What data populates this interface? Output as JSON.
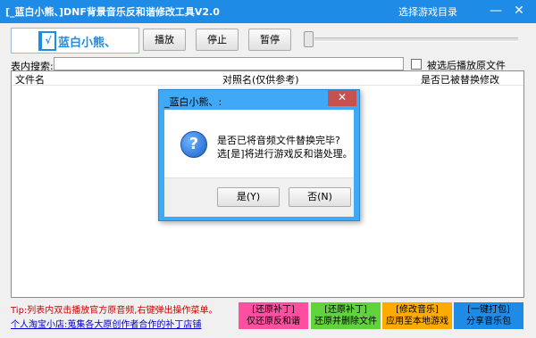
{
  "window": {
    "title": "[_蓝白小熊、]DNF背景音乐反和谐修改工具V2.0",
    "menu": "选择游戏目录",
    "minimize": "—",
    "close": "✕"
  },
  "logo": {
    "glyph": "√",
    "text": "蓝白小熊、"
  },
  "toolbar": {
    "play": "播放",
    "stop": "停止",
    "pause": "暂停"
  },
  "slider": {
    "value": 0
  },
  "search": {
    "label": "表内搜索:",
    "value": "",
    "placeholder": ""
  },
  "options": {
    "play_after_select": "被选后播放原文件",
    "checked": false
  },
  "list": {
    "columns": [
      "文件名",
      "对照名(仅供参考)",
      "是否已被替换修改"
    ],
    "rows": []
  },
  "tip": "Tip:列表内双击播放官方原音频,右键弹出操作菜单。",
  "shop_link": "个人淘宝小店:蒐集各大原创作者合作的补丁店铺",
  "actions": [
    {
      "line1": "[还原补丁]",
      "line2": "仅还原反和谐",
      "color": "#ff4fa1"
    },
    {
      "line1": "[还原补丁]",
      "line2": "还原并删除文件",
      "color": "#5fd23c"
    },
    {
      "line1": "[修改音乐]",
      "line2": "应用至本地游戏",
      "color": "#ffaa00"
    },
    {
      "line1": "[一键打包]",
      "line2": "分享音乐包",
      "color": "#1e8be6"
    }
  ],
  "dialog": {
    "title": "_蓝白小熊、:",
    "close": "✕",
    "icon": "question-icon",
    "line1": "是否已将音频文件替换完毕?",
    "line2": "选[是]将进行游戏反和谐处理。",
    "yes": "是(Y)",
    "no": "否(N)"
  },
  "colors": {
    "titlebar": "#1e8be6",
    "dialog_frame": "#3fa9f5",
    "tip": "#d00000",
    "link": "#0000cc"
  }
}
